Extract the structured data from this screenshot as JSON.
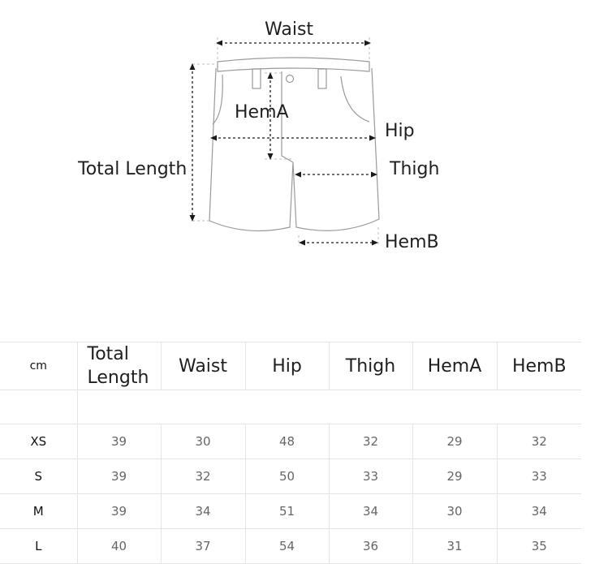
{
  "diagram": {
    "labels": {
      "waist": "Waist",
      "hem_a": "HemA",
      "hip": "Hip",
      "total_length": "Total Length",
      "thigh": "Thigh",
      "hem_b": "HemB"
    }
  },
  "table": {
    "unit": "cm",
    "columns": [
      "Total Length",
      "Waist",
      "Hip",
      "Thigh",
      "HemA",
      "HemB"
    ],
    "rows": [
      {
        "size": "XS",
        "values": [
          "39",
          "30",
          "48",
          "32",
          "29",
          "32"
        ]
      },
      {
        "size": "S",
        "values": [
          "39",
          "32",
          "50",
          "33",
          "29",
          "33"
        ]
      },
      {
        "size": "M",
        "values": [
          "39",
          "34",
          "51",
          "34",
          "30",
          "34"
        ]
      },
      {
        "size": "L",
        "values": [
          "40",
          "37",
          "54",
          "36",
          "31",
          "35"
        ]
      }
    ]
  },
  "colors": {
    "outline": "#9a9a9a",
    "arrow": "#1a1a1a",
    "grid": "#e4e4e4"
  }
}
